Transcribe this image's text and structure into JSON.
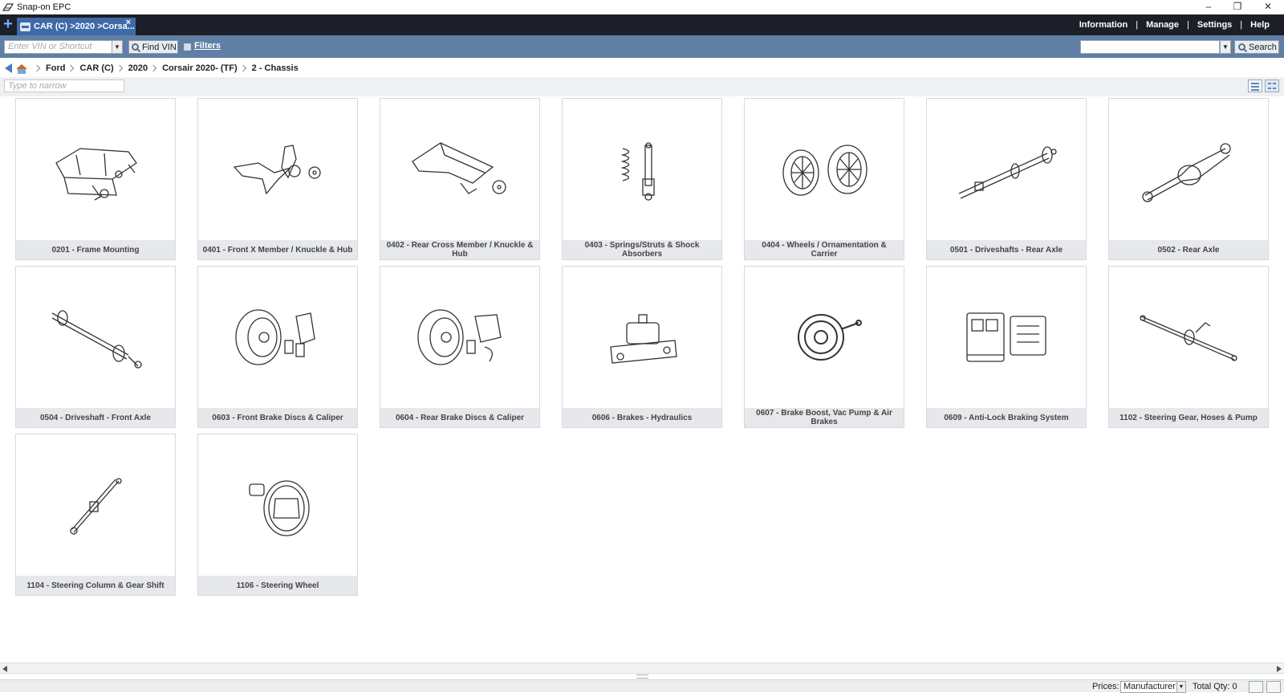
{
  "window": {
    "title": "Snap-on EPC"
  },
  "tabbar": {
    "active_tab": "CAR (C) >2020 >Corsa...",
    "nav": [
      "Information",
      "Manage",
      "Settings",
      "Help"
    ]
  },
  "toolbar": {
    "vin_placeholder": "Enter VIN or Shortcut",
    "find_vin": "Find VIN",
    "filters": "Filters",
    "search_label": "Search"
  },
  "breadcrumb": [
    "Ford",
    "CAR (C)",
    "2020",
    "Corsair 2020- (TF)",
    "2 - Chassis"
  ],
  "narrow": {
    "placeholder": "Type to narrow"
  },
  "groups": [
    {
      "label": "0201 - Frame Mounting",
      "icon": "frame-icon"
    },
    {
      "label": "0401 - Front X Member / Knuckle & Hub",
      "icon": "knuckle-icon"
    },
    {
      "label": "0402 - Rear Cross Member / Knuckle & Hub",
      "icon": "rear-crossmember-icon"
    },
    {
      "label": "0403 - Springs/Struts & Shock Absorbers",
      "icon": "spring-icon"
    },
    {
      "label": "0404 - Wheels / Ornamentation & Carrier",
      "icon": "wheel-icon"
    },
    {
      "label": "0501 - Driveshafts - Rear Axle",
      "icon": "driveshaft-icon"
    },
    {
      "label": "0502 - Rear Axle",
      "icon": "rear-axle-icon"
    },
    {
      "label": "0504 - Driveshaft - Front Axle",
      "icon": "halfshaft-icon"
    },
    {
      "label": "0603 - Front Brake Discs & Caliper",
      "icon": "brake-disc-icon"
    },
    {
      "label": "0604 - Rear Brake Discs & Caliper",
      "icon": "brake-disc-icon"
    },
    {
      "label": "0606 - Brakes - Hydraulics",
      "icon": "master-cylinder-icon"
    },
    {
      "label": "0607 - Brake Boost, Vac Pump & Air Brakes",
      "icon": "brake-booster-icon"
    },
    {
      "label": "0609 - Anti-Lock Braking System",
      "icon": "abs-module-icon"
    },
    {
      "label": "1102 - Steering Gear, Hoses & Pump",
      "icon": "steering-rack-icon"
    },
    {
      "label": "1104 - Steering Column & Gear Shift",
      "icon": "steering-column-icon"
    },
    {
      "label": "1106 - Steering Wheel",
      "icon": "steering-wheel-icon"
    }
  ],
  "status": {
    "prices_label": "Prices:",
    "prices_value": "Manufacturer",
    "total_qty": "Total Qty: 0"
  }
}
